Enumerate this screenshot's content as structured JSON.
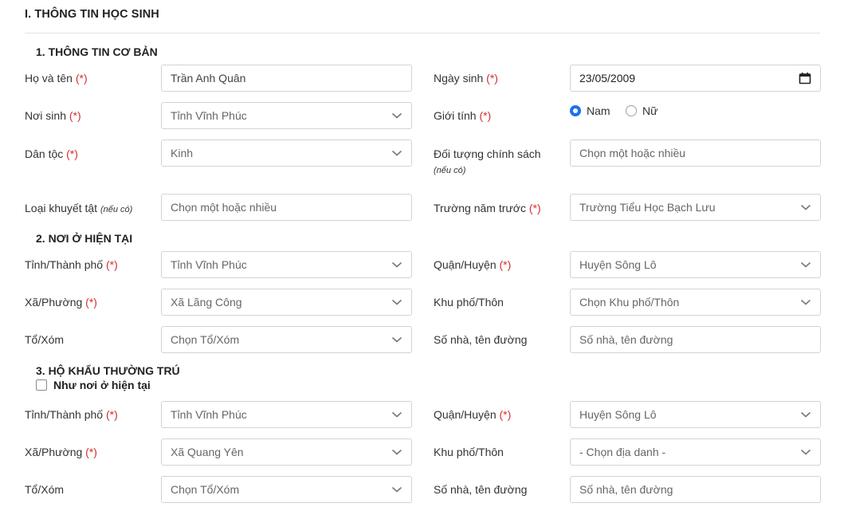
{
  "section": {
    "title": "I. THÔNG TIN HỌC SINH"
  },
  "basic": {
    "heading": "1. THÔNG TIN CƠ BẢN",
    "fullname_label": "Họ và tên",
    "fullname_value": "Trần Anh Quân",
    "dob_label": "Ngày sinh",
    "dob_value": "23/05/2009",
    "birthplace_label": "Nơi sinh",
    "birthplace_value": "Tỉnh Vĩnh Phúc",
    "gender_label": "Giới tính",
    "gender_male": "Nam",
    "gender_female": "Nữ",
    "gender_selected": "Nam",
    "ethnicity_label": "Dân tộc",
    "ethnicity_value": "Kinh",
    "policy_label": "Đối tượng chính sách",
    "policy_note": "(nếu có)",
    "policy_placeholder": "Chọn một hoặc nhiều",
    "disability_label": "Loại khuyết tật",
    "disability_note": "(nếu có)",
    "disability_placeholder": "Chọn một hoặc nhiều",
    "prev_school_label": "Trường năm trước",
    "prev_school_value": "Trường Tiểu Học Bạch Lưu"
  },
  "current": {
    "heading": "2. NƠI Ở HIỆN TẠI",
    "province_label": "Tỉnh/Thành phố",
    "province_value": "Tỉnh Vĩnh Phúc",
    "district_label": "Quận/Huyện",
    "district_value": "Huyện Sông Lô",
    "ward_label": "Xã/Phường",
    "ward_value": "Xã Lãng Công",
    "hamlet_label": "Khu phố/Thôn",
    "hamlet_placeholder": "Chọn Khu phố/Thôn",
    "group_label": "Tổ/Xóm",
    "group_placeholder": "Chọn Tổ/Xóm",
    "street_label": "Số nhà, tên đường",
    "street_placeholder": "Số nhà, tên đường"
  },
  "permanent": {
    "heading": "3. HỘ KHẨU THƯỜNG TRÚ",
    "same_as_current_label": "Như nơi ở hiện tại",
    "province_label": "Tỉnh/Thành phố",
    "province_value": "Tỉnh Vĩnh Phúc",
    "district_label": "Quận/Huyện",
    "district_value": "Huyện Sông Lô",
    "ward_label": "Xã/Phường",
    "ward_value": "Xã Quang Yên",
    "hamlet_label": "Khu phố/Thôn",
    "hamlet_placeholder": "- Chọn địa danh -",
    "group_label": "Tổ/Xóm",
    "group_placeholder": "Chọn Tổ/Xóm",
    "street_label": "Số nhà, tên đường",
    "street_placeholder": "Số nhà, tên đường"
  },
  "required_mark": "(*)",
  "colors": {
    "required": "#d32f2f",
    "accent": "#1a73e8",
    "border": "#cfd4da"
  }
}
